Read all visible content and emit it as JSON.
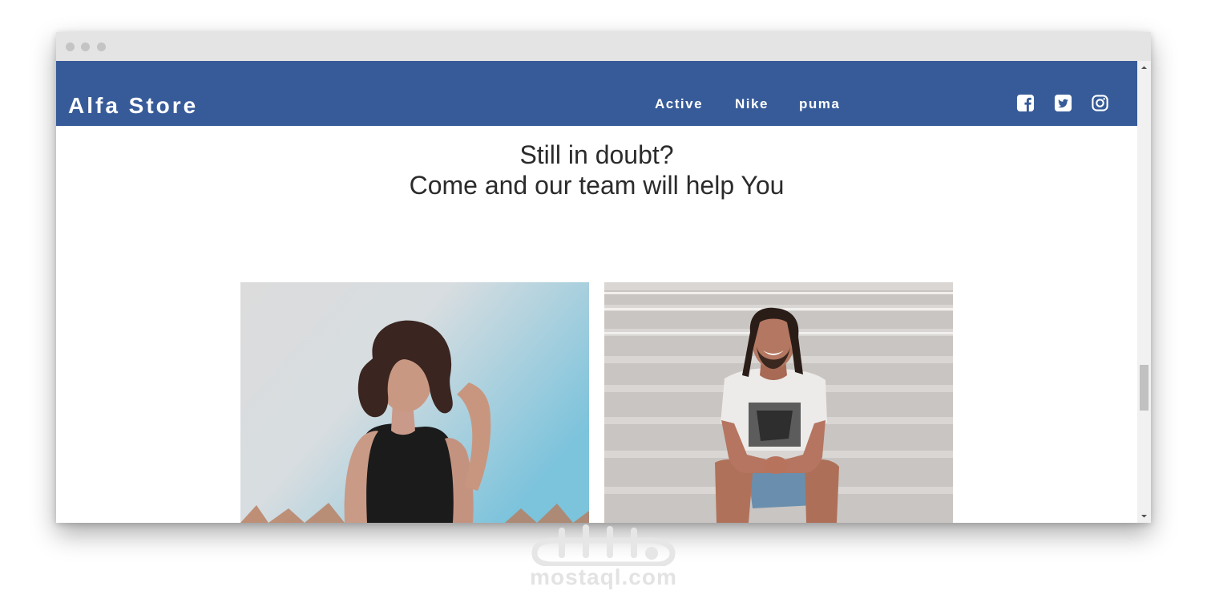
{
  "navbar": {
    "brand": "Alfa Store",
    "links": [
      "Active",
      "Nike",
      "puma"
    ],
    "background_color": "#375b99",
    "social_icons": [
      "facebook-icon",
      "twitter-icon",
      "instagram-icon"
    ]
  },
  "hero": {
    "line1": "Still in doubt?",
    "line2": "Come and our team will help You"
  },
  "photos": [
    {
      "name": "woman-portrait-photo"
    },
    {
      "name": "man-on-stairs-photo"
    }
  ],
  "watermark": {
    "text": "mostaql.com"
  }
}
